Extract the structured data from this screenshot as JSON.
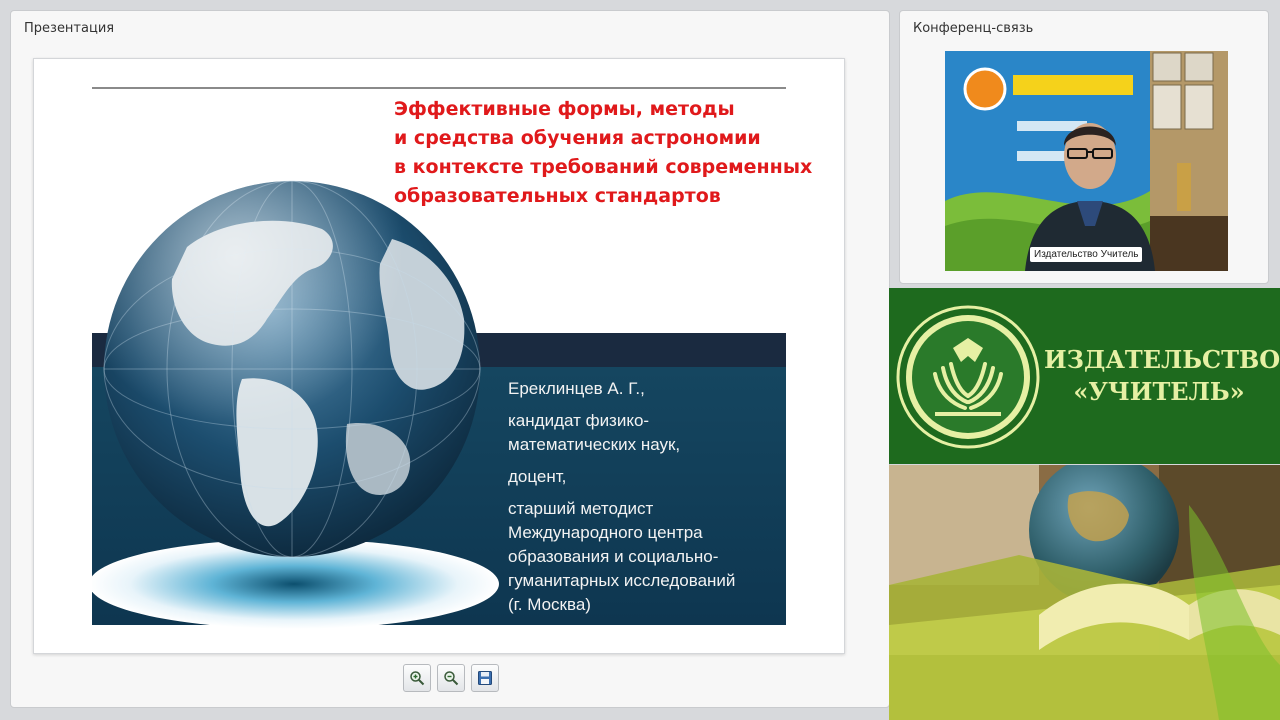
{
  "presentation": {
    "panel_title": "Презентация",
    "slide": {
      "title_lines": [
        "Эффективные формы, методы",
        "и средства обучения астрономии",
        "в контексте требований современных",
        "образовательных стандартов"
      ],
      "author_lines": [
        "Ереклинцев А. Г.,",
        "кандидат физико-",
        "математических наук,",
        "доцент,",
        "старший методист",
        "Международного центра",
        "образования и социально-",
        "гуманитарных исследований",
        "(г. Москва)"
      ],
      "colors": {
        "title": "#e0191b",
        "band_dark": "#1a2a40",
        "band_teal": "#154660"
      }
    },
    "toolbar": {
      "zoom_in_icon": "zoom-in-magnifier",
      "zoom_out_icon": "zoom-out-magnifier",
      "save_icon": "floppy-disk"
    }
  },
  "conference": {
    "panel_title": "Конференц-связь",
    "video_label": "Издательство Учитель"
  },
  "publisher": {
    "name_line1": "ИЗДАТЕЛЬСТВО",
    "name_line2": "«УЧИТЕЛЬ»",
    "colors": {
      "background": "#1e6a1e",
      "text": "#e6f0a4"
    }
  }
}
